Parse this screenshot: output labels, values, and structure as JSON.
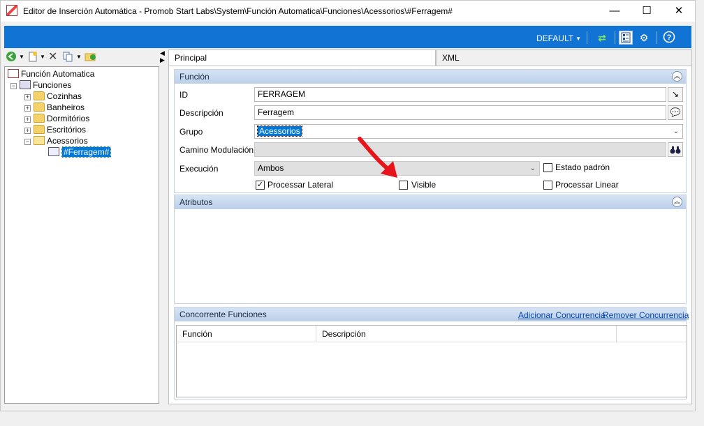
{
  "window": {
    "title": "Editor de Inserción Automática - Promob Start Labs\\System\\Función Automatica\\Funciones\\Acessorios\\#Ferragem#",
    "minimize": "—",
    "maximize": "☐",
    "close": "✕"
  },
  "toolbar": {
    "profile": "DEFAULT"
  },
  "tree": {
    "root": "Función Automatica",
    "funciones": "Funciones",
    "folders": [
      "Cozinhas",
      "Banheiros",
      "Dormitórios",
      "Escritórios",
      "Acessorios"
    ],
    "selected": "#Ferragem#"
  },
  "tabs": {
    "principal": "Principal",
    "xml": "XML"
  },
  "funcion": {
    "header": "Función",
    "id_label": "ID",
    "id_value": "FERRAGEM",
    "descripcion_label": "Descripción",
    "descripcion_value": "Ferragem",
    "grupo_label": "Grupo",
    "grupo_value": "Acessorios",
    "camino_label": "Camino Modulación",
    "camino_value": "",
    "execucion_label": "Execución",
    "execucion_value": "Ambos",
    "estado_padron_label": "Estado padrón",
    "estado_padron_checked": false,
    "processar_lateral_label": "Processar Lateral",
    "processar_lateral_checked": true,
    "visible_label": "Visible",
    "visible_checked": false,
    "processar_linear_label": "Processar Linear",
    "processar_linear_checked": false
  },
  "atributos": {
    "header": "Atributos"
  },
  "concorrente": {
    "header": "Concorrente Funciones",
    "add_link": "Adicionar Concurrencia",
    "remove_link": "Remover Concurrencia",
    "columns": [
      "Función",
      "Descripción"
    ]
  },
  "colors": {
    "toolbar_blue": "#1173d4",
    "selection_blue": "#0078d7",
    "annotation_red": "#e8141b"
  }
}
